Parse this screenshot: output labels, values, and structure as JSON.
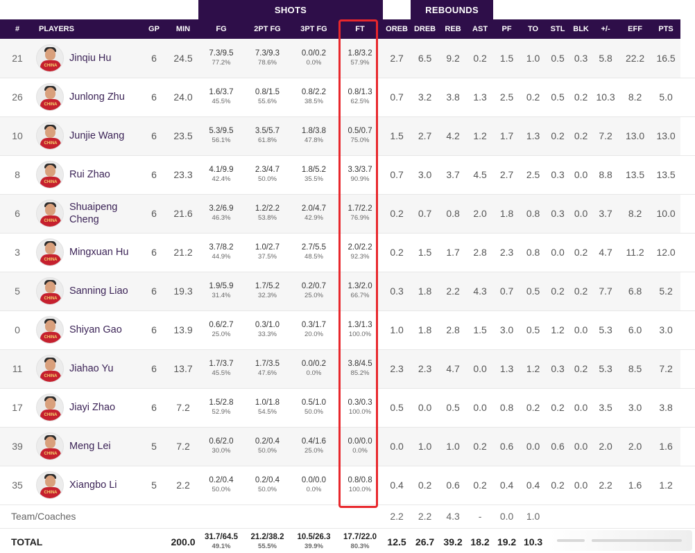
{
  "group_headers": {
    "shots": "SHOTS",
    "rebounds": "REBOUNDS"
  },
  "columns": {
    "num": "#",
    "players": "PLAYERS",
    "gp": "GP",
    "min": "MIN",
    "fg": "FG",
    "fg2": "2PT FG",
    "fg3": "3PT FG",
    "ft": "FT",
    "oreb": "OREB",
    "dreb": "DREB",
    "reb": "REB",
    "ast": "AST",
    "pf": "PF",
    "to": "TO",
    "stl": "STL",
    "blk": "BLK",
    "pm": "+/-",
    "eff": "EFF",
    "pts": "PTS"
  },
  "players": [
    {
      "num": "21",
      "name": "Jinqiu Hu",
      "gp": "6",
      "min": "24.5",
      "fg": "7.3/9.5",
      "fg_pct": "77.2%",
      "fg2": "7.3/9.3",
      "fg2_pct": "78.6%",
      "fg3": "0.0/0.2",
      "fg3_pct": "0.0%",
      "ft": "1.8/3.2",
      "ft_pct": "57.9%",
      "oreb": "2.7",
      "dreb": "6.5",
      "reb": "9.2",
      "ast": "0.2",
      "pf": "1.5",
      "to": "1.0",
      "stl": "0.5",
      "blk": "0.3",
      "pm": "5.8",
      "eff": "22.2",
      "pts": "16.5"
    },
    {
      "num": "26",
      "name": "Junlong Zhu",
      "gp": "6",
      "min": "24.0",
      "fg": "1.6/3.7",
      "fg_pct": "45.5%",
      "fg2": "0.8/1.5",
      "fg2_pct": "55.6%",
      "fg3": "0.8/2.2",
      "fg3_pct": "38.5%",
      "ft": "0.8/1.3",
      "ft_pct": "62.5%",
      "oreb": "0.7",
      "dreb": "3.2",
      "reb": "3.8",
      "ast": "1.3",
      "pf": "2.5",
      "to": "0.2",
      "stl": "0.5",
      "blk": "0.2",
      "pm": "10.3",
      "eff": "8.2",
      "pts": "5.0"
    },
    {
      "num": "10",
      "name": "Junjie Wang",
      "gp": "6",
      "min": "23.5",
      "fg": "5.3/9.5",
      "fg_pct": "56.1%",
      "fg2": "3.5/5.7",
      "fg2_pct": "61.8%",
      "fg3": "1.8/3.8",
      "fg3_pct": "47.8%",
      "ft": "0.5/0.7",
      "ft_pct": "75.0%",
      "oreb": "1.5",
      "dreb": "2.7",
      "reb": "4.2",
      "ast": "1.2",
      "pf": "1.7",
      "to": "1.3",
      "stl": "0.2",
      "blk": "0.2",
      "pm": "7.2",
      "eff": "13.0",
      "pts": "13.0"
    },
    {
      "num": "8",
      "name": "Rui Zhao",
      "gp": "6",
      "min": "23.3",
      "fg": "4.1/9.9",
      "fg_pct": "42.4%",
      "fg2": "2.3/4.7",
      "fg2_pct": "50.0%",
      "fg3": "1.8/5.2",
      "fg3_pct": "35.5%",
      "ft": "3.3/3.7",
      "ft_pct": "90.9%",
      "oreb": "0.7",
      "dreb": "3.0",
      "reb": "3.7",
      "ast": "4.5",
      "pf": "2.7",
      "to": "2.5",
      "stl": "0.3",
      "blk": "0.0",
      "pm": "8.8",
      "eff": "13.5",
      "pts": "13.5"
    },
    {
      "num": "6",
      "name": "Shuaipeng Cheng",
      "gp": "6",
      "min": "21.6",
      "fg": "3.2/6.9",
      "fg_pct": "46.3%",
      "fg2": "1.2/2.2",
      "fg2_pct": "53.8%",
      "fg3": "2.0/4.7",
      "fg3_pct": "42.9%",
      "ft": "1.7/2.2",
      "ft_pct": "76.9%",
      "oreb": "0.2",
      "dreb": "0.7",
      "reb": "0.8",
      "ast": "2.0",
      "pf": "1.8",
      "to": "0.8",
      "stl": "0.3",
      "blk": "0.0",
      "pm": "3.7",
      "eff": "8.2",
      "pts": "10.0"
    },
    {
      "num": "3",
      "name": "Mingxuan Hu",
      "gp": "6",
      "min": "21.2",
      "fg": "3.7/8.2",
      "fg_pct": "44.9%",
      "fg2": "1.0/2.7",
      "fg2_pct": "37.5%",
      "fg3": "2.7/5.5",
      "fg3_pct": "48.5%",
      "ft": "2.0/2.2",
      "ft_pct": "92.3%",
      "oreb": "0.2",
      "dreb": "1.5",
      "reb": "1.7",
      "ast": "2.8",
      "pf": "2.3",
      "to": "0.8",
      "stl": "0.0",
      "blk": "0.2",
      "pm": "4.7",
      "eff": "11.2",
      "pts": "12.0"
    },
    {
      "num": "5",
      "name": "Sanning Liao",
      "gp": "6",
      "min": "19.3",
      "fg": "1.9/5.9",
      "fg_pct": "31.4%",
      "fg2": "1.7/5.2",
      "fg2_pct": "32.3%",
      "fg3": "0.2/0.7",
      "fg3_pct": "25.0%",
      "ft": "1.3/2.0",
      "ft_pct": "66.7%",
      "oreb": "0.3",
      "dreb": "1.8",
      "reb": "2.2",
      "ast": "4.3",
      "pf": "0.7",
      "to": "0.5",
      "stl": "0.2",
      "blk": "0.2",
      "pm": "7.7",
      "eff": "6.8",
      "pts": "5.2"
    },
    {
      "num": "0",
      "name": "Shiyan Gao",
      "gp": "6",
      "min": "13.9",
      "fg": "0.6/2.7",
      "fg_pct": "25.0%",
      "fg2": "0.3/1.0",
      "fg2_pct": "33.3%",
      "fg3": "0.3/1.7",
      "fg3_pct": "20.0%",
      "ft": "1.3/1.3",
      "ft_pct": "100.0%",
      "oreb": "1.0",
      "dreb": "1.8",
      "reb": "2.8",
      "ast": "1.5",
      "pf": "3.0",
      "to": "0.5",
      "stl": "1.2",
      "blk": "0.0",
      "pm": "5.3",
      "eff": "6.0",
      "pts": "3.0"
    },
    {
      "num": "11",
      "name": "Jiahao Yu",
      "gp": "6",
      "min": "13.7",
      "fg": "1.7/3.7",
      "fg_pct": "45.5%",
      "fg2": "1.7/3.5",
      "fg2_pct": "47.6%",
      "fg3": "0.0/0.2",
      "fg3_pct": "0.0%",
      "ft": "3.8/4.5",
      "ft_pct": "85.2%",
      "oreb": "2.3",
      "dreb": "2.3",
      "reb": "4.7",
      "ast": "0.0",
      "pf": "1.3",
      "to": "1.2",
      "stl": "0.3",
      "blk": "0.2",
      "pm": "5.3",
      "eff": "8.5",
      "pts": "7.2"
    },
    {
      "num": "17",
      "name": "Jiayi Zhao",
      "gp": "6",
      "min": "7.2",
      "fg": "1.5/2.8",
      "fg_pct": "52.9%",
      "fg2": "1.0/1.8",
      "fg2_pct": "54.5%",
      "fg3": "0.5/1.0",
      "fg3_pct": "50.0%",
      "ft": "0.3/0.3",
      "ft_pct": "100.0%",
      "oreb": "0.5",
      "dreb": "0.0",
      "reb": "0.5",
      "ast": "0.0",
      "pf": "0.8",
      "to": "0.2",
      "stl": "0.2",
      "blk": "0.0",
      "pm": "3.5",
      "eff": "3.0",
      "pts": "3.8"
    },
    {
      "num": "39",
      "name": "Meng Lei",
      "gp": "5",
      "min": "7.2",
      "fg": "0.6/2.0",
      "fg_pct": "30.0%",
      "fg2": "0.2/0.4",
      "fg2_pct": "50.0%",
      "fg3": "0.4/1.6",
      "fg3_pct": "25.0%",
      "ft": "0.0/0.0",
      "ft_pct": "0.0%",
      "oreb": "0.0",
      "dreb": "1.0",
      "reb": "1.0",
      "ast": "0.2",
      "pf": "0.6",
      "to": "0.0",
      "stl": "0.6",
      "blk": "0.0",
      "pm": "2.0",
      "eff": "2.0",
      "pts": "1.6"
    },
    {
      "num": "35",
      "name": "Xiangbo Li",
      "gp": "5",
      "min": "2.2",
      "fg": "0.2/0.4",
      "fg_pct": "50.0%",
      "fg2": "0.2/0.4",
      "fg2_pct": "50.0%",
      "fg3": "0.0/0.0",
      "fg3_pct": "0.0%",
      "ft": "0.8/0.8",
      "ft_pct": "100.0%",
      "oreb": "0.4",
      "dreb": "0.2",
      "reb": "0.6",
      "ast": "0.2",
      "pf": "0.4",
      "to": "0.4",
      "stl": "0.2",
      "blk": "0.0",
      "pm": "2.2",
      "eff": "1.6",
      "pts": "1.2"
    }
  ],
  "team_row": {
    "label": "Team/Coaches",
    "oreb": "2.2",
    "dreb": "2.2",
    "reb": "4.3",
    "ast": "-",
    "pf": "0.0",
    "to": "1.0"
  },
  "total_row": {
    "label": "TOTAL",
    "min": "200.0",
    "fg": "31.7/64.5",
    "fg_pct": "49.1%",
    "fg2": "21.2/38.2",
    "fg2_pct": "55.5%",
    "fg3": "10.5/26.3",
    "fg3_pct": "39.9%",
    "ft": "17.7/22.0",
    "ft_pct": "80.3%",
    "oreb": "12.5",
    "dreb": "26.7",
    "reb": "39.2",
    "ast": "18.2",
    "pf": "19.2",
    "to": "10.3"
  },
  "jersey_text": "CHINA",
  "colors": {
    "header_bg": "#2e0e49",
    "highlight": "#e8272c",
    "player_name": "#3b2356"
  }
}
